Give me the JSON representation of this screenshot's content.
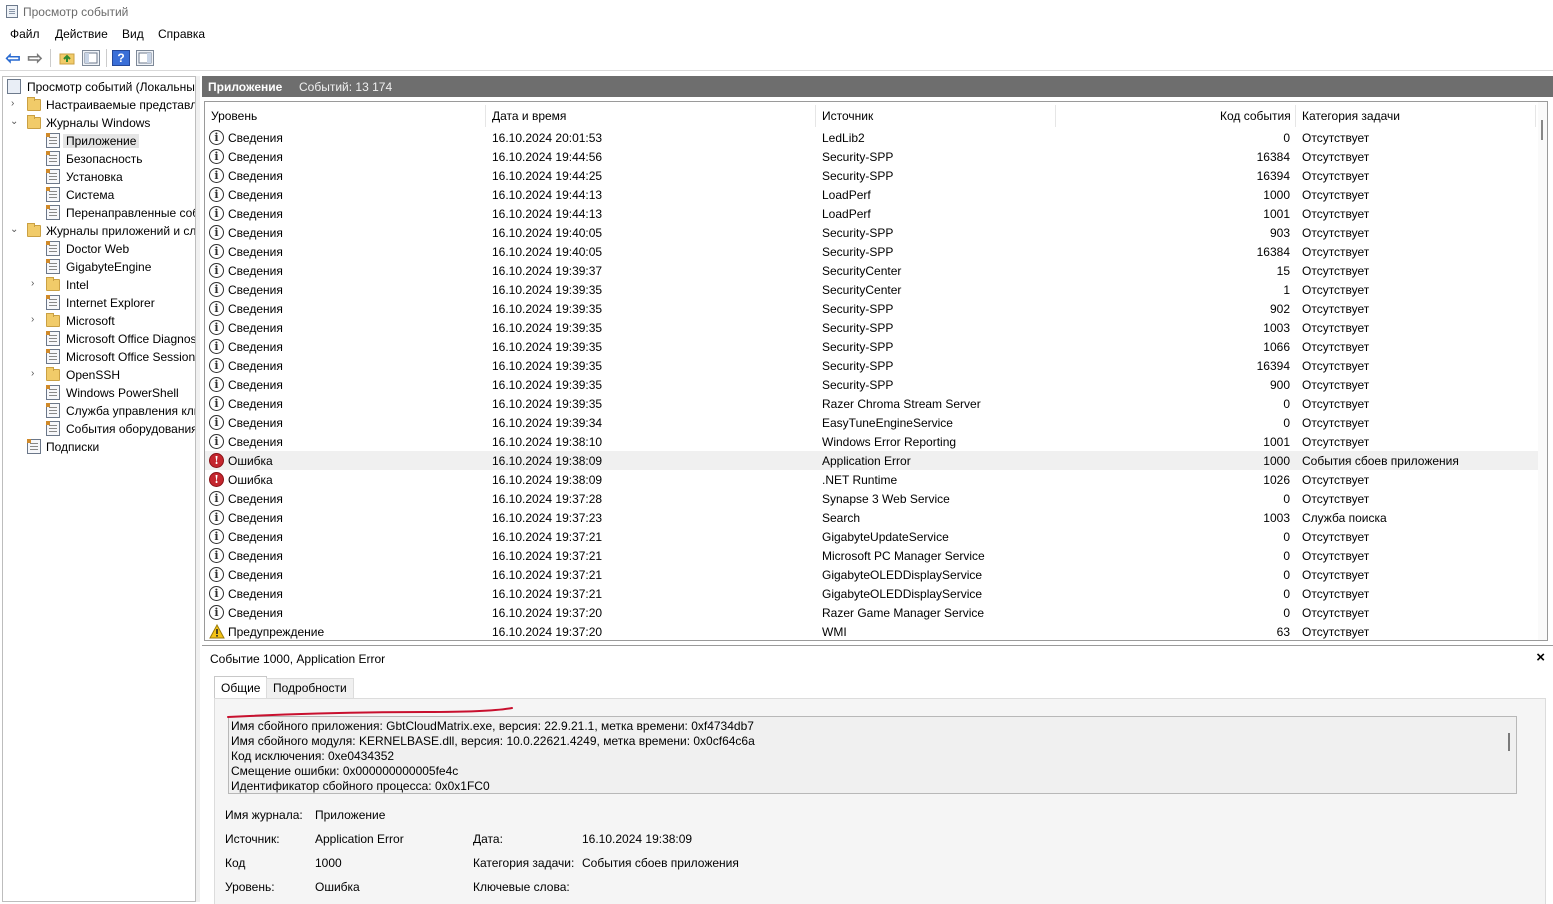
{
  "window": {
    "title": "Просмотр событий"
  },
  "menu": {
    "file": "Файл",
    "action": "Действие",
    "view": "Вид",
    "help": "Справка"
  },
  "tree": {
    "root": "Просмотр событий (Локальный)",
    "custom_views": "Настраиваемые представления",
    "windows_logs": "Журналы Windows",
    "application": "Приложение",
    "security": "Безопасность",
    "setup": "Установка",
    "system": "Система",
    "forwarded": "Перенаправленные события",
    "app_services_logs": "Журналы приложений и служб",
    "doctor_web": "Doctor Web",
    "gigabyte_engine": "GigabyteEngine",
    "intel": "Intel",
    "internet_explorer": "Internet Explorer",
    "microsoft": "Microsoft",
    "ms_office_diag": "Microsoft Office Diagnostics",
    "ms_office_sessions": "Microsoft Office Sessions",
    "openssh": "OpenSSH",
    "powershell": "Windows PowerShell",
    "key_mgmt": "Служба управления ключами",
    "hw_events": "События оборудования",
    "subscriptions": "Подписки"
  },
  "pane": {
    "title": "Приложение",
    "count": "Событий: 13 174"
  },
  "columns": {
    "level": "Уровень",
    "datetime": "Дата и время",
    "source": "Источник",
    "event_id": "Код события",
    "task": "Категория задачи"
  },
  "events": [
    {
      "level": "Сведения",
      "type": "info",
      "datetime": "16.10.2024 20:01:53",
      "source": "LedLib2",
      "id": "0",
      "task": "Отсутствует"
    },
    {
      "level": "Сведения",
      "type": "info",
      "datetime": "16.10.2024 19:44:56",
      "source": "Security-SPP",
      "id": "16384",
      "task": "Отсутствует"
    },
    {
      "level": "Сведения",
      "type": "info",
      "datetime": "16.10.2024 19:44:25",
      "source": "Security-SPP",
      "id": "16394",
      "task": "Отсутствует"
    },
    {
      "level": "Сведения",
      "type": "info",
      "datetime": "16.10.2024 19:44:13",
      "source": "LoadPerf",
      "id": "1000",
      "task": "Отсутствует"
    },
    {
      "level": "Сведения",
      "type": "info",
      "datetime": "16.10.2024 19:44:13",
      "source": "LoadPerf",
      "id": "1001",
      "task": "Отсутствует"
    },
    {
      "level": "Сведения",
      "type": "info",
      "datetime": "16.10.2024 19:40:05",
      "source": "Security-SPP",
      "id": "903",
      "task": "Отсутствует"
    },
    {
      "level": "Сведения",
      "type": "info",
      "datetime": "16.10.2024 19:40:05",
      "source": "Security-SPP",
      "id": "16384",
      "task": "Отсутствует"
    },
    {
      "level": "Сведения",
      "type": "info",
      "datetime": "16.10.2024 19:39:37",
      "source": "SecurityCenter",
      "id": "15",
      "task": "Отсутствует"
    },
    {
      "level": "Сведения",
      "type": "info",
      "datetime": "16.10.2024 19:39:35",
      "source": "SecurityCenter",
      "id": "1",
      "task": "Отсутствует"
    },
    {
      "level": "Сведения",
      "type": "info",
      "datetime": "16.10.2024 19:39:35",
      "source": "Security-SPP",
      "id": "902",
      "task": "Отсутствует"
    },
    {
      "level": "Сведения",
      "type": "info",
      "datetime": "16.10.2024 19:39:35",
      "source": "Security-SPP",
      "id": "1003",
      "task": "Отсутствует"
    },
    {
      "level": "Сведения",
      "type": "info",
      "datetime": "16.10.2024 19:39:35",
      "source": "Security-SPP",
      "id": "1066",
      "task": "Отсутствует"
    },
    {
      "level": "Сведения",
      "type": "info",
      "datetime": "16.10.2024 19:39:35",
      "source": "Security-SPP",
      "id": "16394",
      "task": "Отсутствует"
    },
    {
      "level": "Сведения",
      "type": "info",
      "datetime": "16.10.2024 19:39:35",
      "source": "Security-SPP",
      "id": "900",
      "task": "Отсутствует"
    },
    {
      "level": "Сведения",
      "type": "info",
      "datetime": "16.10.2024 19:39:35",
      "source": "Razer Chroma Stream Server",
      "id": "0",
      "task": "Отсутствует"
    },
    {
      "level": "Сведения",
      "type": "info",
      "datetime": "16.10.2024 19:39:34",
      "source": "EasyTuneEngineService",
      "id": "0",
      "task": "Отсутствует"
    },
    {
      "level": "Сведения",
      "type": "info",
      "datetime": "16.10.2024 19:38:10",
      "source": "Windows Error Reporting",
      "id": "1001",
      "task": "Отсутствует"
    },
    {
      "level": "Ошибка",
      "type": "err",
      "datetime": "16.10.2024 19:38:09",
      "source": "Application Error",
      "id": "1000",
      "task": "События сбоев приложения",
      "selected": true
    },
    {
      "level": "Ошибка",
      "type": "err",
      "datetime": "16.10.2024 19:38:09",
      "source": ".NET Runtime",
      "id": "1026",
      "task": "Отсутствует"
    },
    {
      "level": "Сведения",
      "type": "info",
      "datetime": "16.10.2024 19:37:28",
      "source": "Synapse 3 Web Service",
      "id": "0",
      "task": "Отсутствует"
    },
    {
      "level": "Сведения",
      "type": "info",
      "datetime": "16.10.2024 19:37:23",
      "source": "Search",
      "id": "1003",
      "task": "Служба поиска"
    },
    {
      "level": "Сведения",
      "type": "info",
      "datetime": "16.10.2024 19:37:21",
      "source": "GigabyteUpdateService",
      "id": "0",
      "task": "Отсутствует"
    },
    {
      "level": "Сведения",
      "type": "info",
      "datetime": "16.10.2024 19:37:21",
      "source": "Microsoft PC Manager Service",
      "id": "0",
      "task": "Отсутствует"
    },
    {
      "level": "Сведения",
      "type": "info",
      "datetime": "16.10.2024 19:37:21",
      "source": "GigabyteOLEDDisplayService",
      "id": "0",
      "task": "Отсутствует"
    },
    {
      "level": "Сведения",
      "type": "info",
      "datetime": "16.10.2024 19:37:21",
      "source": "GigabyteOLEDDisplayService",
      "id": "0",
      "task": "Отсутствует"
    },
    {
      "level": "Сведения",
      "type": "info",
      "datetime": "16.10.2024 19:37:20",
      "source": "Razer Game Manager Service",
      "id": "0",
      "task": "Отсутствует"
    },
    {
      "level": "Предупреждение",
      "type": "warn",
      "datetime": "16.10.2024 19:37:20",
      "source": "WMI",
      "id": "63",
      "task": "Отсутствует"
    }
  ],
  "detail": {
    "header": "Событие 1000, Application Error",
    "tab_general": "Общие",
    "tab_details": "Подробности",
    "lines": [
      "Имя сбойного приложения: GbtCloudMatrix.exe, версия: 22.9.21.1, метка времени: 0xf4734db7",
      "Имя сбойного модуля: KERNELBASE.dll, версия: 10.0.22621.4249, метка времени: 0x0cf64c6a",
      "Код исключения: 0xe0434352",
      "Смещение ошибки: 0x000000000005fe4c",
      "Идентификатор сбойного процесса: 0x0x1FC0"
    ],
    "log_name_label": "Имя журнала:",
    "log_name": "Приложение",
    "source_label": "Источник:",
    "source": "Application Error",
    "date_label": "Дата:",
    "date": "16.10.2024 19:38:09",
    "code_label": "Код",
    "code": "1000",
    "task_label": "Категория задачи:",
    "task": "События сбоев приложения",
    "level_label": "Уровень:",
    "level": "Ошибка",
    "keywords_label": "Ключевые слова:"
  },
  "colors": {
    "header_bg": "#6e6e6e",
    "error": "#c4262e",
    "annotation": "#c8102e"
  }
}
